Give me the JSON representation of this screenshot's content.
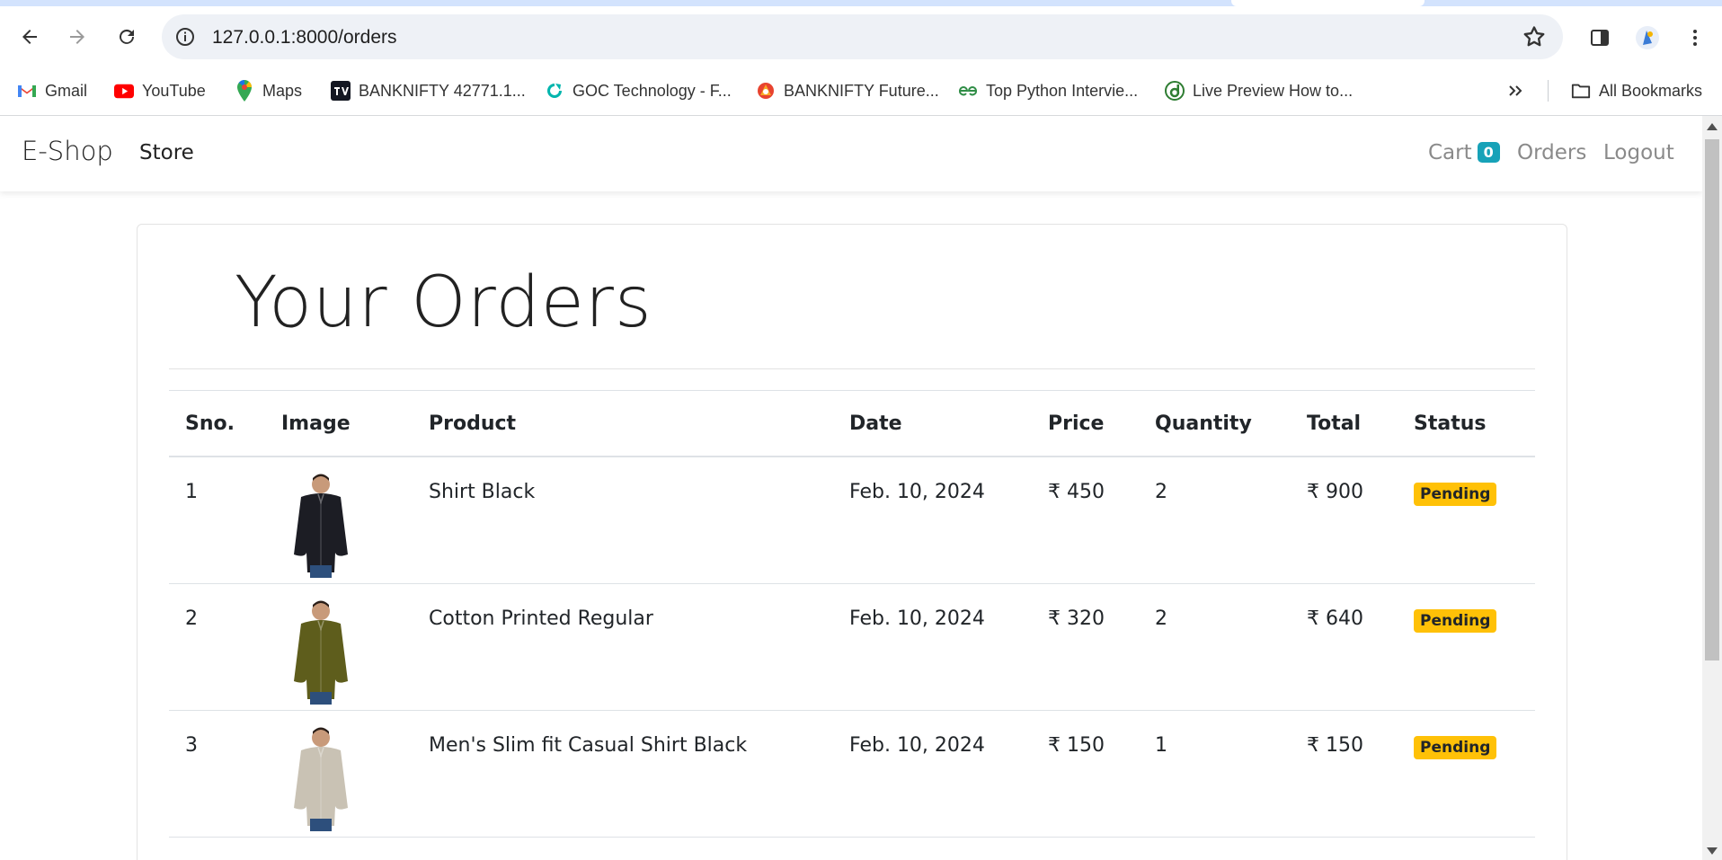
{
  "browser": {
    "url": "127.0.0.1:8000/orders",
    "bookmarks": [
      {
        "label": "Gmail",
        "icon": "gmail-icon"
      },
      {
        "label": "YouTube",
        "icon": "youtube-icon"
      },
      {
        "label": "Maps",
        "icon": "maps-icon"
      },
      {
        "label": "BANKNIFTY 42771.1...",
        "icon": "tradingview-icon"
      },
      {
        "label": "GOC Technology - F...",
        "icon": "goc-icon"
      },
      {
        "label": "BANKNIFTY Future...",
        "icon": "fyers-icon"
      },
      {
        "label": "Top Python Intervie...",
        "icon": "gfg-icon"
      },
      {
        "label": "Live Preview How to...",
        "icon": "livepreview-icon"
      }
    ],
    "all_bookmarks": "All Bookmarks"
  },
  "navbar": {
    "brand": "E-Shop",
    "store": "Store",
    "cart": "Cart",
    "cart_count": "0",
    "orders": "Orders",
    "logout": "Logout"
  },
  "page": {
    "title": "Your Orders",
    "columns": [
      "Sno.",
      "Image",
      "Product",
      "Date",
      "Price",
      "Quantity",
      "Total",
      "Status"
    ],
    "rows": [
      {
        "sno": "1",
        "product": "Shirt Black",
        "date": "Feb. 10, 2024",
        "price": "₹ 450",
        "quantity": "2",
        "total": "₹ 900",
        "status": "Pending",
        "shirt_color": "#1c1d24"
      },
      {
        "sno": "2",
        "product": "Cotton Printed Regular",
        "date": "Feb. 10, 2024",
        "price": "₹ 320",
        "quantity": "2",
        "total": "₹ 640",
        "status": "Pending",
        "shirt_color": "#5e5d1c"
      },
      {
        "sno": "3",
        "product": "Men's Slim fit Casual Shirt Black",
        "date": "Feb. 10, 2024",
        "price": "₹ 150",
        "quantity": "1",
        "total": "₹ 150",
        "status": "Pending",
        "shirt_color": "#c9c2b4"
      }
    ]
  }
}
